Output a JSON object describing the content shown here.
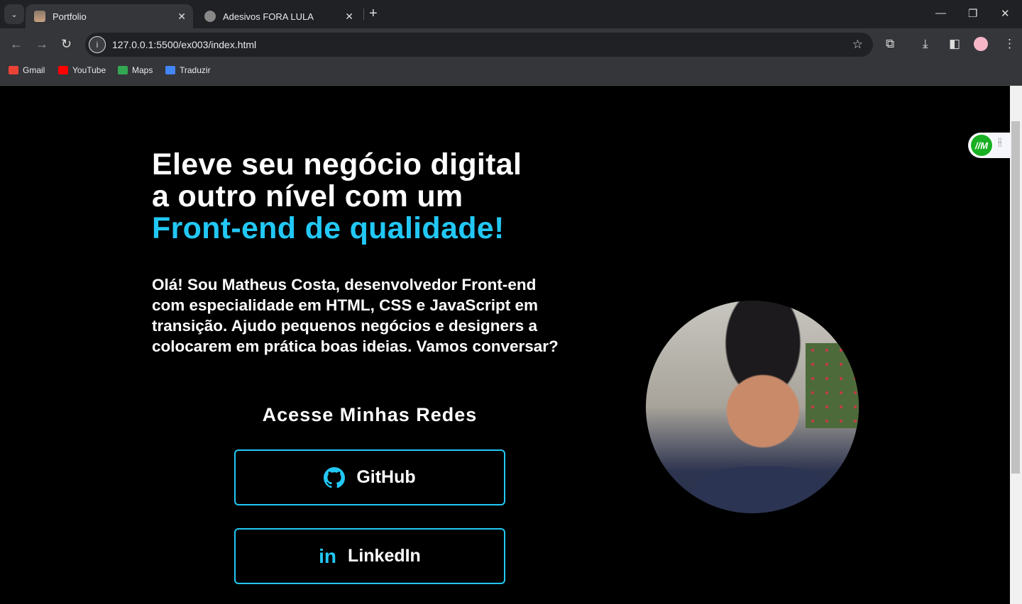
{
  "browser": {
    "tabs": [
      {
        "title": "Portfolio",
        "active": true
      },
      {
        "title": "Adesivos FORA LULA",
        "active": false
      }
    ],
    "url": "127.0.0.1:5500/ex003/index.html",
    "bookmarks": [
      {
        "label": "Gmail",
        "color": "#ea4335"
      },
      {
        "label": "YouTube",
        "color": "#ff0000"
      },
      {
        "label": "Maps",
        "color": "#34a853"
      },
      {
        "label": "Traduzir",
        "color": "#4285f4"
      }
    ]
  },
  "extension": {
    "logo": "IM",
    "color": "#19b024"
  },
  "hero": {
    "title_line1": "Eleve seu negócio digital",
    "title_line2": "a outro nível com um",
    "title_highlight": "Front-end de qualidade!",
    "intro": "Olá! Sou Matheus Costa, desenvolvedor Front-end com especialidade em HTML, CSS e JavaScript em transição. Ajudo pequenos negócios e designers a colocarem em prática boas ideias. Vamos conversar?",
    "social_heading": "Acesse Minhas Redes",
    "github_label": "GitHub",
    "linkedin_label": "LinkedIn",
    "accent": "#22c8f5"
  }
}
